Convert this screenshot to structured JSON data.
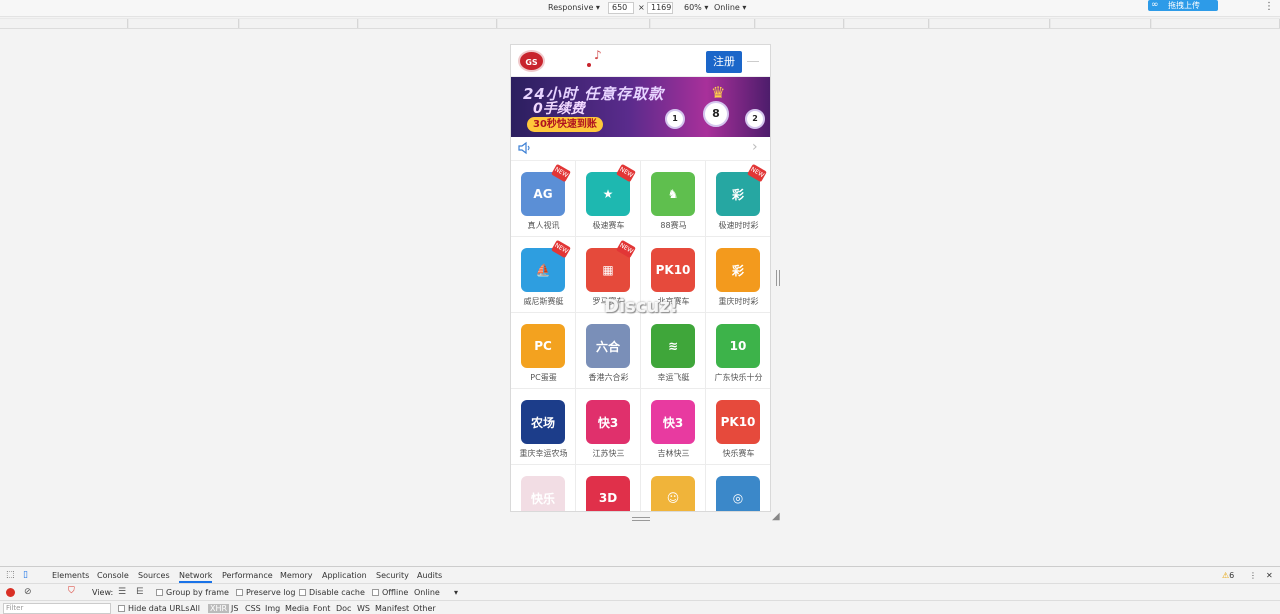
{
  "device_toolbar": {
    "mode": "Responsive",
    "width": "650",
    "times": "×",
    "height": "1169",
    "zoom": "60%",
    "network": "Online",
    "upload_label": "拖拽上传"
  },
  "phone": {
    "logo_text": "GS",
    "register_label": "注册",
    "banner": {
      "line1": "24小时 任意存取款",
      "line2": "0手续费",
      "line3": "30秒快速到账",
      "balls": [
        "1",
        "8",
        "2"
      ]
    },
    "grid": [
      {
        "label": "真人视讯",
        "icon": "AG",
        "color": "#5b8fd6",
        "new": true
      },
      {
        "label": "极速赛车",
        "icon": "★",
        "color": "#1eb8b0",
        "new": true
      },
      {
        "label": "88赛马",
        "icon": "♞",
        "color": "#5fbf4e",
        "new": false
      },
      {
        "label": "极速时时彩",
        "icon": "彩",
        "color": "#26a7a2",
        "new": true
      },
      {
        "label": "威尼斯赛艇",
        "icon": "⛵",
        "color": "#2e9ee0",
        "new": true
      },
      {
        "label": "罗马赛车",
        "icon": "▦",
        "color": "#e54a3b",
        "new": true
      },
      {
        "label": "北京赛车",
        "icon": "PK10",
        "color": "#e64a3c",
        "new": false
      },
      {
        "label": "重庆时时彩",
        "icon": "彩",
        "color": "#f39a1d",
        "new": false
      },
      {
        "label": "PC蛋蛋",
        "icon": "PC",
        "color": "#f3a21f",
        "new": false
      },
      {
        "label": "香港六合彩",
        "icon": "六合",
        "color": "#7a8fb8",
        "new": false
      },
      {
        "label": "幸运飞艇",
        "icon": "≋",
        "color": "#3fa63a",
        "new": false
      },
      {
        "label": "广东快乐十分",
        "icon": "10",
        "color": "#3db34a",
        "new": false
      },
      {
        "label": "重庆幸运农场",
        "icon": "农场",
        "color": "#1c3d8a",
        "new": false
      },
      {
        "label": "江苏快三",
        "icon": "快3",
        "color": "#e0306c",
        "new": false
      },
      {
        "label": "吉林快三",
        "icon": "快3",
        "color": "#e83aa0",
        "new": false
      },
      {
        "label": "快乐赛车",
        "icon": "PK10",
        "color": "#e64a3c",
        "new": false
      },
      {
        "label": "",
        "icon": "快乐",
        "color": "#f2dde4",
        "new": false
      },
      {
        "label": "",
        "icon": "3D",
        "color": "#e0304a",
        "new": false
      },
      {
        "label": "",
        "icon": "☺",
        "color": "#f0b43a",
        "new": false
      },
      {
        "label": "",
        "icon": "◎",
        "color": "#3b88c9",
        "new": false
      }
    ]
  },
  "watermark": "Discuz!",
  "devtools": {
    "tabs": [
      "Elements",
      "Console",
      "Sources",
      "Network",
      "Performance",
      "Memory",
      "Application",
      "Security",
      "Audits"
    ],
    "active_tab": "Network",
    "warning_count": "6",
    "row2": {
      "view_label": "View:",
      "group_by_frame": "Group by frame",
      "preserve_log": "Preserve log",
      "disable_cache": "Disable cache",
      "offline": "Offline",
      "online": "Online"
    },
    "filter_placeholder": "Filter",
    "row3": {
      "hide_data_urls": "Hide data URLs",
      "types": [
        "All",
        "XHR",
        "JS",
        "CSS",
        "Img",
        "Media",
        "Font",
        "Doc",
        "WS",
        "Manifest",
        "Other"
      ]
    }
  }
}
